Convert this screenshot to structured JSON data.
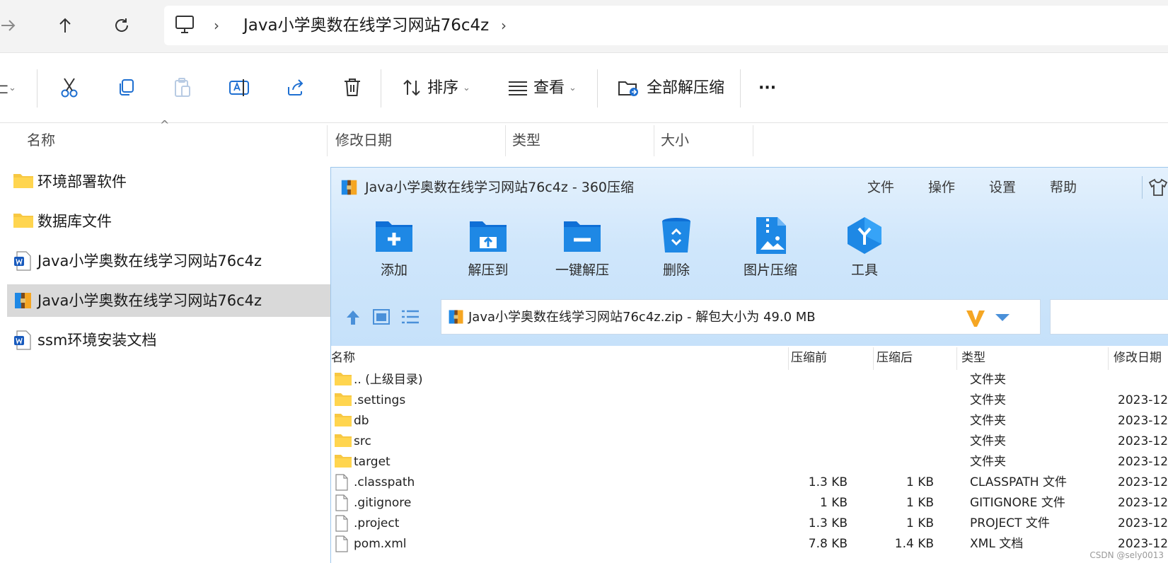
{
  "explorer": {
    "breadcrumb": [
      "Java小学奥数在线学习网站76c4z"
    ],
    "toolbar": {
      "sort_label": "排序",
      "view_label": "查看",
      "extract_all_label": "全部解压缩",
      "more_label": "···"
    },
    "columns": {
      "name": "名称",
      "modified": "修改日期",
      "type": "类型",
      "size": "大小"
    },
    "files": [
      {
        "name": "环境部署软件",
        "icon": "folder-icon"
      },
      {
        "name": "数据库文件",
        "icon": "folder-icon"
      },
      {
        "name": "Java小学奥数在线学习网站76c4z",
        "icon": "word-doc-icon"
      },
      {
        "name": "Java小学奥数在线学习网站76c4z",
        "icon": "zip-archive-icon",
        "selected": true
      },
      {
        "name": "ssm环境安装文档",
        "icon": "word-doc-icon"
      }
    ]
  },
  "zip_window": {
    "title": "Java小学奥数在线学习网站76c4z - 360压缩",
    "menu": [
      "文件",
      "操作",
      "设置",
      "帮助"
    ],
    "tools": [
      {
        "label": "添加",
        "icon": "add-folder-icon"
      },
      {
        "label": "解压到",
        "icon": "extract-to-icon"
      },
      {
        "label": "一键解压",
        "icon": "one-click-extract-icon"
      },
      {
        "label": "删除",
        "icon": "recycle-bin-icon"
      },
      {
        "label": "图片压缩",
        "icon": "image-compress-icon"
      },
      {
        "label": "工具",
        "icon": "tools-icon"
      }
    ],
    "path": "Java小学奥数在线学习网站76c4z.zip - 解包大小为 49.0 MB",
    "columns": {
      "name": "名称",
      "before": "压缩前",
      "after": "压缩后",
      "type": "类型",
      "date": "修改日期"
    },
    "rows": [
      {
        "name": ".. (上级目录)",
        "before": "",
        "after": "",
        "type": "文件夹",
        "date": "",
        "icon": "folder-icon"
      },
      {
        "name": ".settings",
        "before": "",
        "after": "",
        "type": "文件夹",
        "date": "2023-12",
        "icon": "folder-icon"
      },
      {
        "name": "db",
        "before": "",
        "after": "",
        "type": "文件夹",
        "date": "2023-12",
        "icon": "folder-icon"
      },
      {
        "name": "src",
        "before": "",
        "after": "",
        "type": "文件夹",
        "date": "2023-12",
        "icon": "folder-icon"
      },
      {
        "name": "target",
        "before": "",
        "after": "",
        "type": "文件夹",
        "date": "2023-12",
        "icon": "folder-icon"
      },
      {
        "name": ".classpath",
        "before": "1.3 KB",
        "after": "1 KB",
        "type": "CLASSPATH 文件",
        "date": "2023-12",
        "icon": "file-icon"
      },
      {
        "name": ".gitignore",
        "before": "1 KB",
        "after": "1 KB",
        "type": "GITIGNORE 文件",
        "date": "2023-12",
        "icon": "file-icon"
      },
      {
        "name": ".project",
        "before": "1.3 KB",
        "after": "1 KB",
        "type": "PROJECT 文件",
        "date": "2023-12",
        "icon": "file-icon"
      },
      {
        "name": "pom.xml",
        "before": "7.8 KB",
        "after": "1.4 KB",
        "type": "XML 文档",
        "date": "2023-12",
        "icon": "file-icon"
      }
    ]
  },
  "watermark": "CSDN @sely0013",
  "colors": {
    "accent_blue": "#1e88e5",
    "selection_gray": "#d9d9d9",
    "zip_header": "#cfe6fb",
    "folder_yellow": "#f7c843"
  }
}
